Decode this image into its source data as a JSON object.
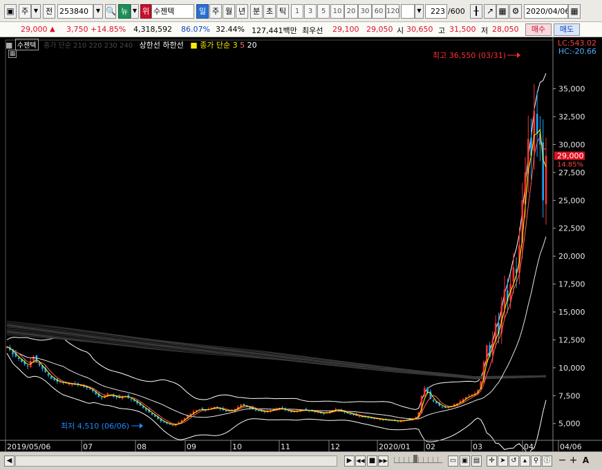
{
  "toolbar": {
    "market_type": "주",
    "market_flag": "전",
    "stock_code": "253840",
    "news_label": "뉴",
    "tag_label": "위",
    "stock_name": "수젠텍",
    "period_day": "일",
    "period_week": "주",
    "period_month": "월",
    "period_year": "년",
    "period_min": "분",
    "period_sec": "초",
    "period_tick": "틱",
    "intervals": [
      "1",
      "3",
      "5",
      "10",
      "20",
      "30",
      "60",
      "120"
    ],
    "bar_count": "223",
    "bar_total": "/600",
    "date": "2020/04/06"
  },
  "quote": {
    "price": "29,000",
    "change": "3,750",
    "change_pct": "+14.85%",
    "volume": "4,318,592",
    "ratio1": "86.07%",
    "ratio2": "32.44%",
    "amount": "127,441백만",
    "best_label": "최우선",
    "best_ask": "29,100",
    "best_bid": "29,050",
    "open_label": "시",
    "open": "30,650",
    "high_label": "고",
    "high": "31,500",
    "low_label": "저",
    "low": "28,050",
    "buy_label": "매수",
    "sell_label": "매도"
  },
  "legend": {
    "name": "수젠텍",
    "ma_long": "종가 단순 210 220 230 240",
    "limits": "상한선 하한선",
    "ma_short_label": "종가 단순",
    "ma3": "3",
    "ma5": "5",
    "ma20": "20"
  },
  "chart_data": {
    "type": "candlestick",
    "title": "수젠텍",
    "x_labels": [
      "2019/05/06",
      "07",
      "08",
      "09",
      "10",
      "11",
      "12",
      "2020/01",
      "02",
      "03",
      "04",
      "04/06"
    ],
    "y_ticks": [
      "35,000",
      "32,500",
      "30,000",
      "27,500",
      "25,000",
      "22,500",
      "20,000",
      "17,500",
      "15,000",
      "12,500",
      "10,000",
      "7,500",
      "5,000"
    ],
    "ylim": [
      3500,
      38500
    ],
    "close_series": [
      11900,
      11600,
      11200,
      11000,
      10800,
      10500,
      10300,
      10100,
      10600,
      11000,
      10500,
      10200,
      9900,
      9600,
      9300,
      9000,
      8900,
      8750,
      8700,
      8650,
      8600,
      8550,
      8550,
      8500,
      8450,
      8400,
      8300,
      8200,
      8100,
      7900,
      7600,
      7400,
      7300,
      7450,
      7700,
      7600,
      7400,
      7350,
      7300,
      7450,
      7500,
      7300,
      7150,
      7000,
      6800,
      6600,
      6400,
      6200,
      6000,
      5800,
      5600,
      5400,
      5200,
      5100,
      5000,
      4900,
      4850,
      4950,
      5100,
      5300,
      5500,
      5700,
      5900,
      6100,
      6200,
      6300,
      6250,
      6200,
      6300,
      6400,
      6500,
      6400,
      6300,
      6200,
      6150,
      6100,
      6200,
      6300,
      6500,
      6700,
      6600,
      6500,
      6400,
      6300,
      6200,
      6150,
      6100,
      6050,
      6100,
      6200,
      6300,
      6350,
      6400,
      6300,
      6200,
      6100,
      6050,
      6100,
      6150,
      6200,
      6250,
      6200,
      6150,
      6100,
      6050,
      6000,
      5950,
      5900,
      6000,
      6100,
      6200,
      6300,
      6200,
      6100,
      6000,
      5900,
      5850,
      5800,
      5700,
      5650,
      5600,
      5600,
      5550,
      5500,
      5450,
      5400,
      5400,
      5350,
      5300,
      5300,
      5300,
      5250,
      5200,
      5250,
      5300,
      5350,
      5400,
      5450,
      5500,
      6000,
      7500,
      8200,
      7800,
      7200,
      7000,
      6800,
      6600,
      6500,
      6400,
      6500,
      6600,
      6700,
      6800,
      7000,
      7200,
      7400,
      7500,
      7600,
      7700,
      8000,
      8800,
      10500,
      12000,
      11000,
      12500,
      14000,
      13000,
      15500,
      17000,
      16000,
      17500,
      19000,
      18500,
      21000,
      25000,
      27500,
      30500,
      29000,
      33000,
      31000,
      30000,
      25000,
      29000
    ],
    "annotations": {
      "high": "최고 36,550 (03/31)",
      "low": "최저 4,510 (06/06)"
    },
    "current_price": "29,000",
    "current_pct": "14.85%",
    "lc": "LC:543.02",
    "hc": "HC:-20.66",
    "grid": false,
    "colors": {
      "up": "#ff3030",
      "down": "#1aa8ff",
      "ma3": "#ffff00",
      "ma5": "#ff6060",
      "ma20": "#ffffff"
    }
  },
  "bottom": {
    "prev": "◀",
    "next": "▶",
    "first": "◀◀",
    "stop": "■",
    "last": "▶▶",
    "plus": "+",
    "minus": "−",
    "auto": "A"
  }
}
